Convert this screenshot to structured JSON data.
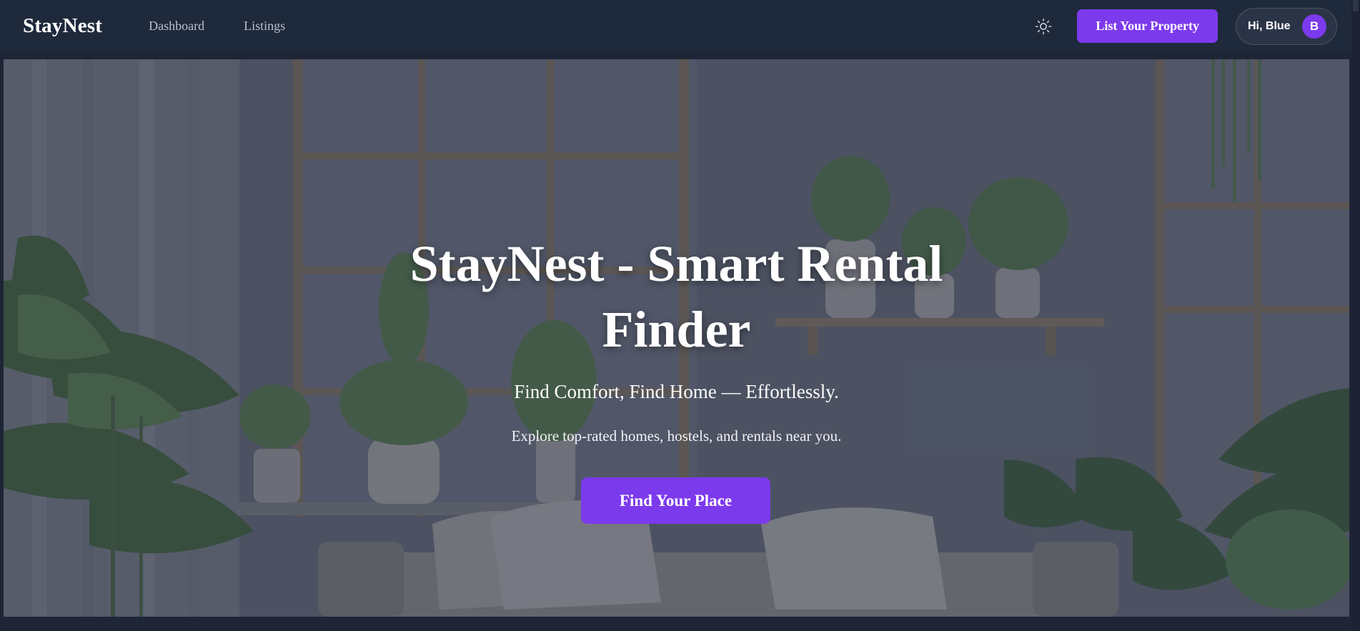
{
  "nav": {
    "brand": "StayNest",
    "links": [
      "Dashboard",
      "Listings"
    ],
    "theme_icon": "sun-icon",
    "list_property_label": "List Your Property",
    "user_greeting": "Hi, Blue",
    "avatar_initial": "B"
  },
  "hero": {
    "title_line1": "StayNest - Smart Rental",
    "title_line2": "Finder",
    "subtitle": "Find Comfort, Find Home — Effortlessly.",
    "description": "Explore top-rated homes, hostels, and rentals near you.",
    "cta_label": "Find Your Place"
  },
  "colors": {
    "nav_bg": "#1e293b",
    "accent": "#7c3aed",
    "nav_link": "#b8c0cc"
  }
}
